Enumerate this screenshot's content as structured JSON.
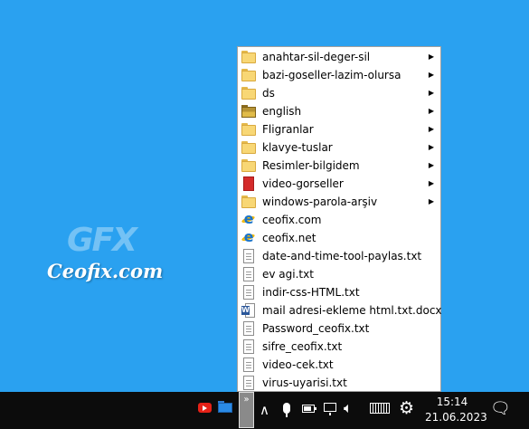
{
  "watermark": {
    "brand": "GFX",
    "site": "Ceofix.com"
  },
  "menu": {
    "items": [
      {
        "label": "anahtar-sil-deger-sil",
        "icon": "folder-icon",
        "submenu": true
      },
      {
        "label": "bazi-goseller-lazim-olursa",
        "icon": "folder-icon",
        "submenu": true
      },
      {
        "label": "ds",
        "icon": "folder-icon",
        "submenu": true
      },
      {
        "label": "english",
        "icon": "folder-dark-icon",
        "submenu": true
      },
      {
        "label": "Fligranlar",
        "icon": "folder-icon",
        "submenu": true
      },
      {
        "label": "klavye-tuslar",
        "icon": "folder-icon",
        "submenu": true
      },
      {
        "label": "Resimler-bilgidem",
        "icon": "folder-icon",
        "submenu": true
      },
      {
        "label": "video-gorseller",
        "icon": "video-folder-icon",
        "submenu": true
      },
      {
        "label": "windows-parola-arşiv",
        "icon": "folder-icon",
        "submenu": true
      },
      {
        "label": "ceofix.com",
        "icon": "ie-icon",
        "submenu": false
      },
      {
        "label": "ceofix.net",
        "icon": "ie-icon",
        "submenu": false
      },
      {
        "label": "date-and-time-tool-paylas.txt",
        "icon": "txt-icon",
        "submenu": false
      },
      {
        "label": "ev agi.txt",
        "icon": "txt-icon",
        "submenu": false
      },
      {
        "label": "indir-css-HTML.txt",
        "icon": "txt-icon",
        "submenu": false
      },
      {
        "label": "mail adresi-ekleme html.txt.docx",
        "icon": "word-icon",
        "submenu": false
      },
      {
        "label": "Password_ceofix.txt",
        "icon": "txt-icon",
        "submenu": false
      },
      {
        "label": "sifre_ceofix.txt",
        "icon": "txt-icon",
        "submenu": false
      },
      {
        "label": "video-cek.txt",
        "icon": "txt-icon",
        "submenu": false
      },
      {
        "label": "virus-uyarisi.txt",
        "icon": "txt-icon",
        "submenu": false
      }
    ],
    "arrow_glyph": "▶"
  },
  "taskbar": {
    "expand_glyph": "»",
    "time": "15:14",
    "date": "21.06.2023",
    "tray_icons": [
      "youtube-icon",
      "folder-toolbar-icon",
      "toolbar-expand-icon",
      "show-hidden-icons-chevron-icon",
      "microphone-icon",
      "battery-icon",
      "network-icon",
      "volume-icon",
      "keyboard-icon",
      "settings-gear-icon",
      "notification-icon"
    ],
    "chevron_glyph": "∧",
    "volume_glyph": "🔈︎",
    "gear_glyph": "⚙",
    "notification_glyph": "🗨"
  }
}
